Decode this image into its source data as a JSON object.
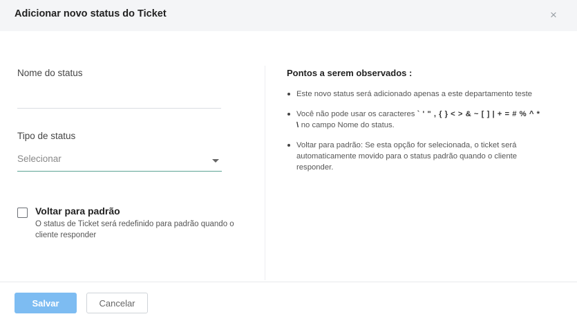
{
  "dialog": {
    "title": "Adicionar novo status do Ticket",
    "close_icon": "×"
  },
  "form": {
    "status_name_label": "Nome do status",
    "status_name_value": "",
    "status_type_label": "Tipo de status",
    "status_type_value": "Selecionar",
    "revert_checked": false,
    "revert_label": "Voltar para padrão",
    "revert_description": "O status de Ticket será redefinido para padrão quando o cliente responder"
  },
  "notes": {
    "title": "Pontos a serem observados :",
    "item1": "Este novo status será adicionado apenas a este departamento teste",
    "item2_prefix": "Você não pode usar os caracteres ",
    "item2_chars": "` ' \" , { } < > & ~ [ ] | + = # % ^ * \\",
    "item2_suffix": " no campo Nome do status.",
    "item3": "Voltar para padrão: Se esta opção for selecionada, o ticket será automaticamente movido para o status padrão quando o cliente responder."
  },
  "footer": {
    "save_label": "Salvar",
    "cancel_label": "Cancelar"
  }
}
